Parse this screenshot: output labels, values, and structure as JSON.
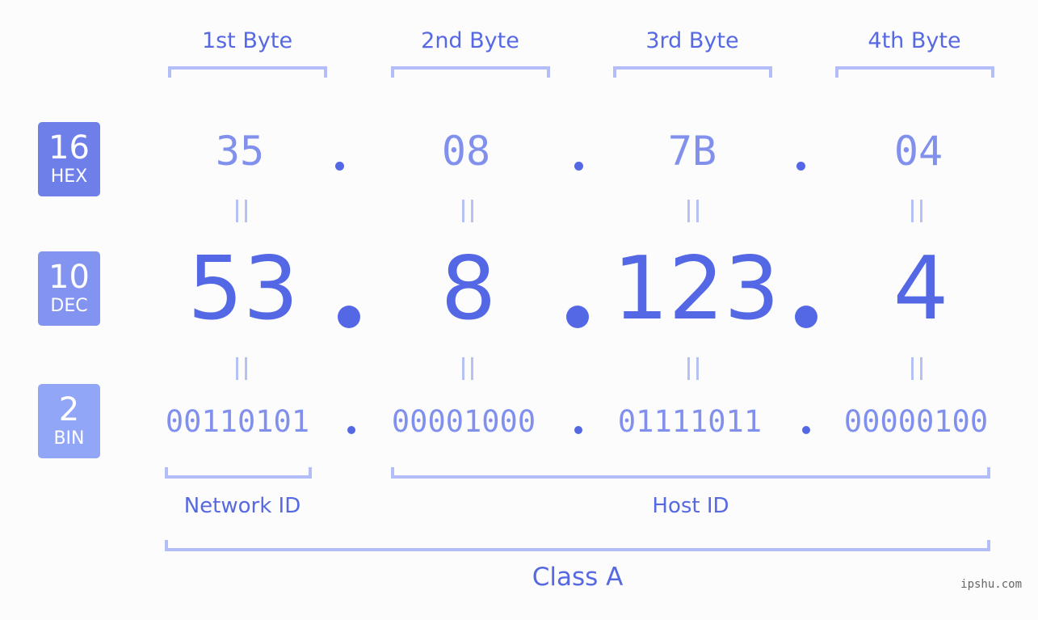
{
  "ip_address": "53.8.123.4",
  "rows": [
    {
      "base": "16",
      "name": "HEX",
      "color": "#6f7fe9"
    },
    {
      "base": "10",
      "name": "DEC",
      "color": "#8393f0"
    },
    {
      "base": "2",
      "name": "BIN",
      "color": "#91a6f7"
    }
  ],
  "bytes": [
    {
      "label": "1st Byte",
      "hex": "35",
      "dec": "53",
      "bin": "00110101"
    },
    {
      "label": "2nd Byte",
      "hex": "08",
      "dec": "8",
      "bin": "00001000"
    },
    {
      "label": "3rd Byte",
      "hex": "7B",
      "dec": "123",
      "bin": "01111011"
    },
    {
      "label": "4th Byte",
      "hex": "04",
      "dec": "4",
      "bin": "00000100"
    }
  ],
  "network_id_label": "Network ID",
  "host_id_label": "Host ID",
  "class_label": "Class A",
  "equals_symbol": "=",
  "watermark": "ipshu.com",
  "colors": {
    "accent": "#5468e6",
    "light_value": "#8090ec",
    "bracket": "#b3bdf7",
    "background": "#fbfcfb"
  }
}
